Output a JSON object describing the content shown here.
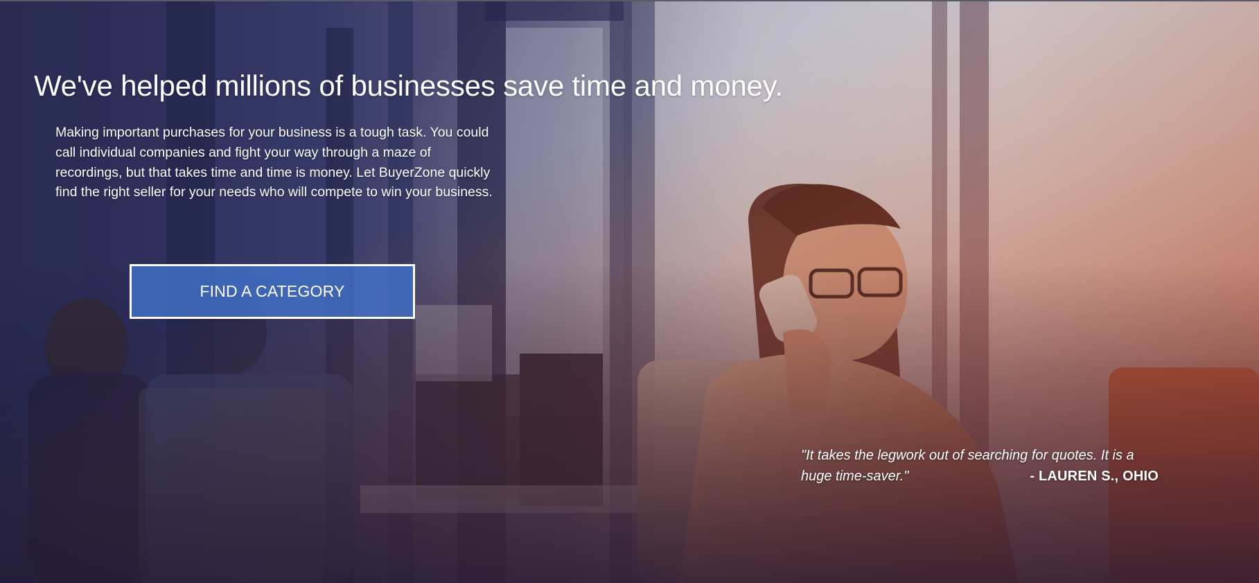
{
  "hero": {
    "headline": "We've helped millions of businesses save time and money.",
    "intro": "Making important purchases for your business is a tough task. You could call individual companies and fight your way through a maze of recordings, but that takes time and time is money. Let BuyerZone quickly find the right seller for your needs who will compete to win your business.",
    "cta_label": "FIND A CATEGORY",
    "cta_color": "#4270C8"
  },
  "testimonial": {
    "quote": "\"It takes the legwork out of searching for quotes. It is a huge time-saver.\"",
    "attribution": "- LAUREN S., OHIO"
  }
}
